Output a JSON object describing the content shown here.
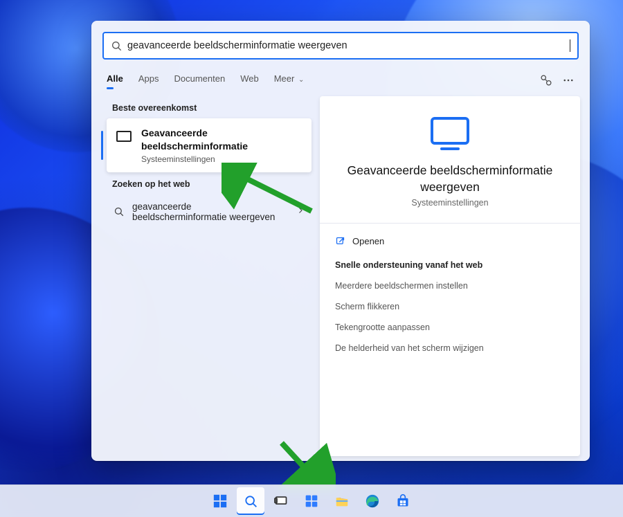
{
  "search": {
    "value": "geavanceerde beeldscherminformatie weergeven"
  },
  "tabs": {
    "alle": "Alle",
    "apps": "Apps",
    "documenten": "Documenten",
    "web": "Web",
    "meer": "Meer"
  },
  "left": {
    "best_label": "Beste overeenkomst",
    "best_title_1": "Geavanceerde",
    "best_title_2": "beeldscherminformatie",
    "best_sub": "Systeeminstellingen",
    "web_label": "Zoeken op het web",
    "web_item_1": "geavanceerde",
    "web_item_2": "beeldscherminformatie weergeven"
  },
  "detail": {
    "title": "Geavanceerde beeldscherminformatie weergeven",
    "sub": "Systeeminstellingen",
    "open_label": "Openen",
    "quick_head": "Snelle ondersteuning vanaf het web",
    "quick_links": {
      "a": "Meerdere beeldschermen instellen",
      "b": "Scherm flikkeren",
      "c": "Tekengrootte aanpassen",
      "d": "De helderheid van het scherm wijzigen"
    }
  },
  "colors": {
    "accent": "#1b6ef3",
    "annotation": "#22a02b"
  }
}
